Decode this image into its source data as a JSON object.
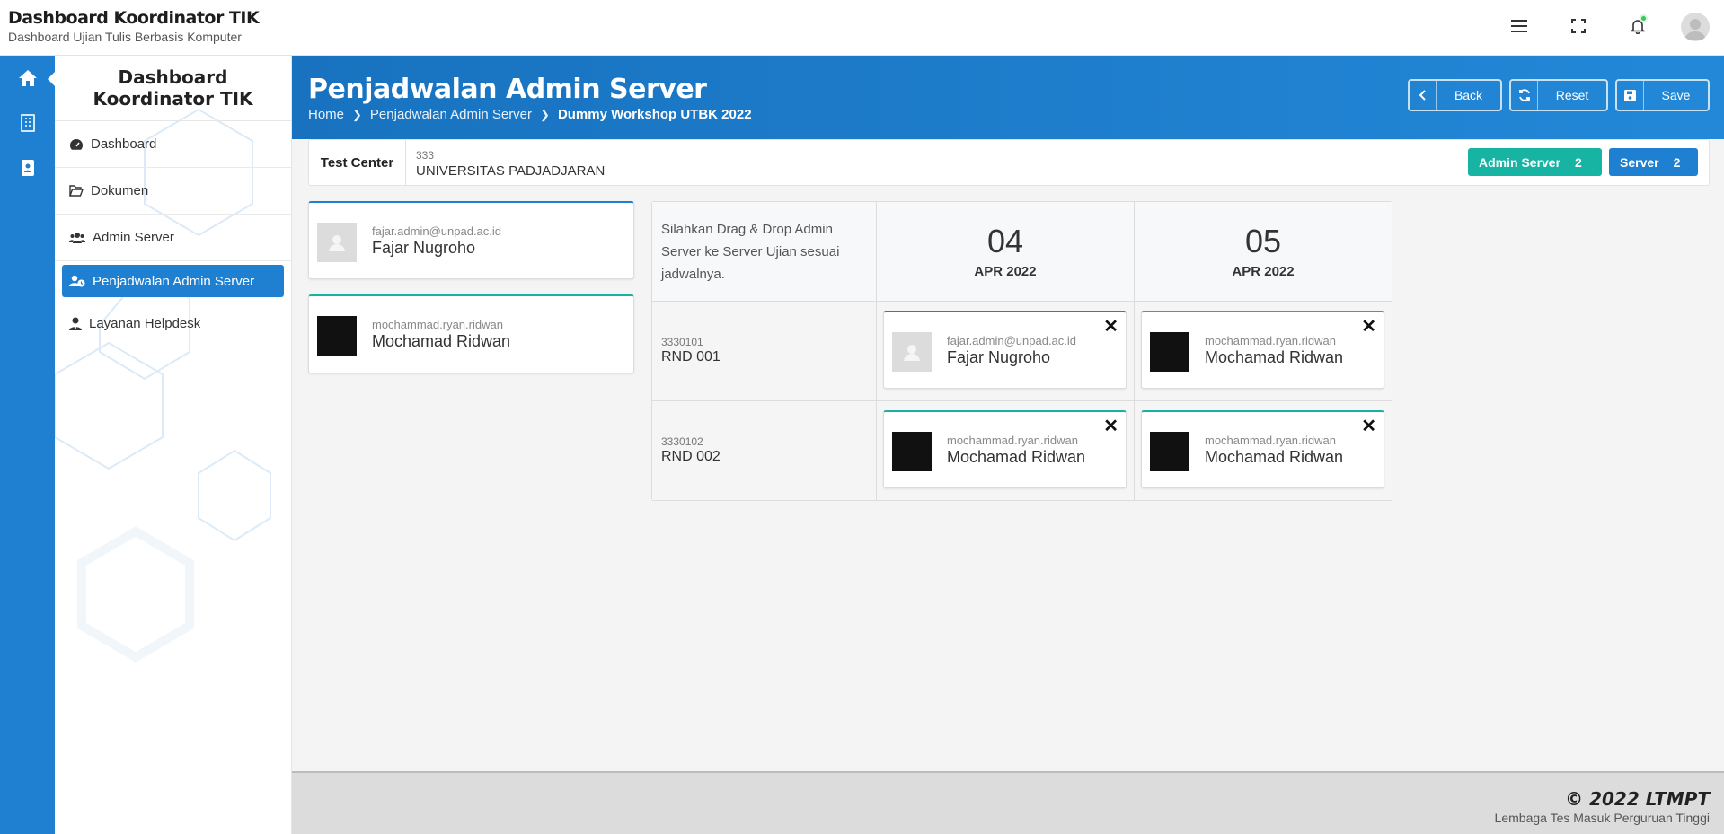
{
  "header": {
    "title": "Dashboard Koordinator TIK",
    "subtitle": "Dashboard Ujian Tulis Berbasis Komputer"
  },
  "sidebar": {
    "title": "Dashboard Koordinator TIK",
    "items": [
      {
        "label": "Dashboard",
        "icon": "dashboard-gauge-icon"
      },
      {
        "label": "Dokumen",
        "icon": "folder-open-icon"
      },
      {
        "label": "Admin Server",
        "icon": "users-icon"
      },
      {
        "label": "Penjadwalan Admin Server",
        "icon": "user-clock-icon",
        "active": true
      },
      {
        "label": "Layanan Helpdesk",
        "icon": "user-tie-icon"
      }
    ]
  },
  "page": {
    "title": "Penjadwalan Admin Server",
    "breadcrumbs": [
      "Home",
      "Penjadwalan Admin Server",
      "Dummy Workshop UTBK 2022"
    ],
    "buttons": {
      "back": "Back",
      "reset": "Reset",
      "save": "Save"
    }
  },
  "test_center": {
    "label": "Test Center",
    "code": "333",
    "name": "UNIVERSITAS PADJADJARAN",
    "badges": [
      {
        "label": "Admin Server",
        "count": "2",
        "color": "#17b3a3"
      },
      {
        "label": "Server",
        "count": "2",
        "color": "#1f7fd0"
      }
    ]
  },
  "admins": [
    {
      "email": "fajar.admin@unpad.ac.id",
      "name": "Fajar Nugroho",
      "photo": "placeholder"
    },
    {
      "email": "mochammad.ryan.ridwan",
      "name": "Mochamad Ridwan",
      "photo": "dark"
    }
  ],
  "schedule": {
    "instruction": "Silahkan Drag & Drop Admin Server ke Server Ujian sesuai jadwalnya.",
    "dates": [
      {
        "day": "04",
        "month": "APR 2022"
      },
      {
        "day": "05",
        "month": "APR 2022"
      }
    ],
    "rows": [
      {
        "code": "3330101",
        "name": "RND 001",
        "slots": [
          {
            "email": "fajar.admin@unpad.ac.id",
            "name": "Fajar Nugroho",
            "photo": "placeholder"
          },
          {
            "email": "mochammad.ryan.ridwan",
            "name": "Mochamad Ridwan",
            "photo": "dark"
          }
        ]
      },
      {
        "code": "3330102",
        "name": "RND 002",
        "slots": [
          {
            "email": "mochammad.ryan.ridwan",
            "name": "Mochamad Ridwan",
            "photo": "dark"
          },
          {
            "email": "mochammad.ryan.ridwan",
            "name": "Mochamad Ridwan",
            "photo": "dark"
          }
        ]
      }
    ]
  },
  "footer": {
    "copyright": "© 2022 LTMPT",
    "org": "Lembaga Tes Masuk Perguruan Tinggi"
  }
}
